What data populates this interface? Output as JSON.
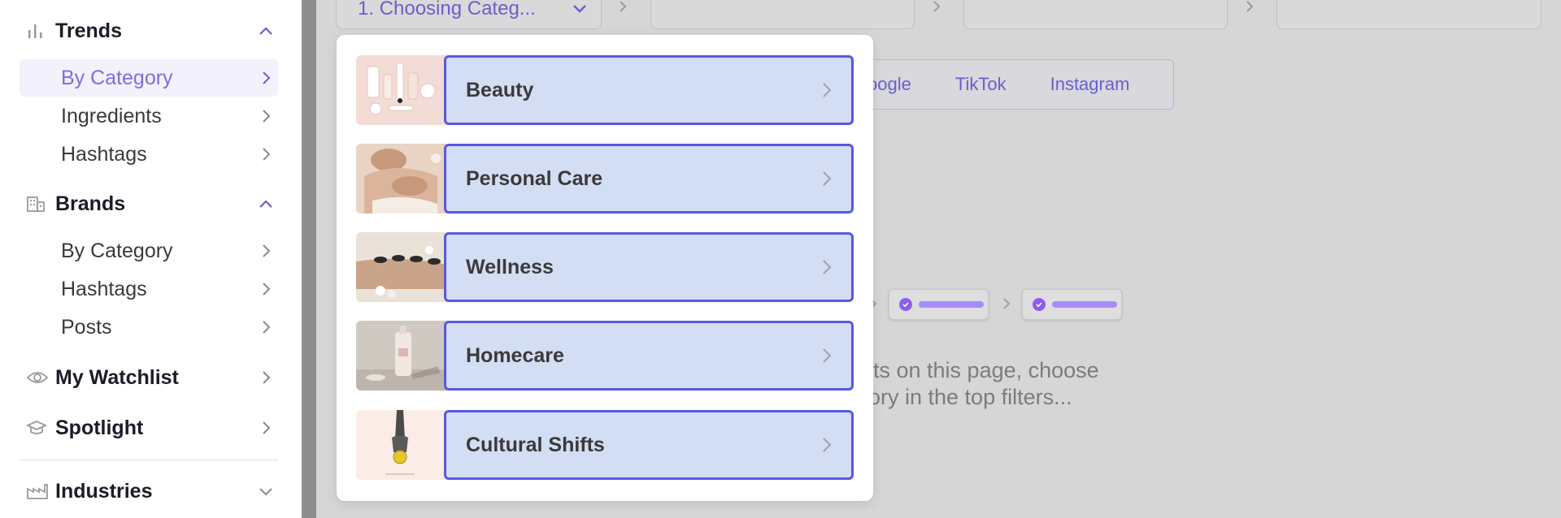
{
  "sidebar": {
    "trends": {
      "title": "Trends",
      "items": [
        {
          "label": "By Category",
          "active": true
        },
        {
          "label": "Ingredients"
        },
        {
          "label": "Hashtags"
        }
      ]
    },
    "brands": {
      "title": "Brands",
      "items": [
        {
          "label": "By Category"
        },
        {
          "label": "Hashtags"
        },
        {
          "label": "Posts"
        }
      ]
    },
    "watchlist": {
      "title": "My Watchlist"
    },
    "spotlight": {
      "title": "Spotlight"
    },
    "industries": {
      "title": "Industries"
    }
  },
  "breadcrumb": {
    "step1_label": "1. Choosing Categ..."
  },
  "platforms": {
    "partial_google": "oogle",
    "tiktok": "TikTok",
    "instagram": "Instagram"
  },
  "hint": {
    "line1": "lts on this page, choose",
    "line2": "ory in the top filters..."
  },
  "dropdown": {
    "categories": [
      {
        "label": "Beauty"
      },
      {
        "label": "Personal Care"
      },
      {
        "label": "Wellness"
      },
      {
        "label": "Homecare"
      },
      {
        "label": "Cultural Shifts"
      }
    ]
  },
  "colors": {
    "accent": "#6a5ed0",
    "category_fill": "#d3ddf3",
    "category_border": "#5b57e0",
    "active_bg": "#f3f1fc"
  }
}
